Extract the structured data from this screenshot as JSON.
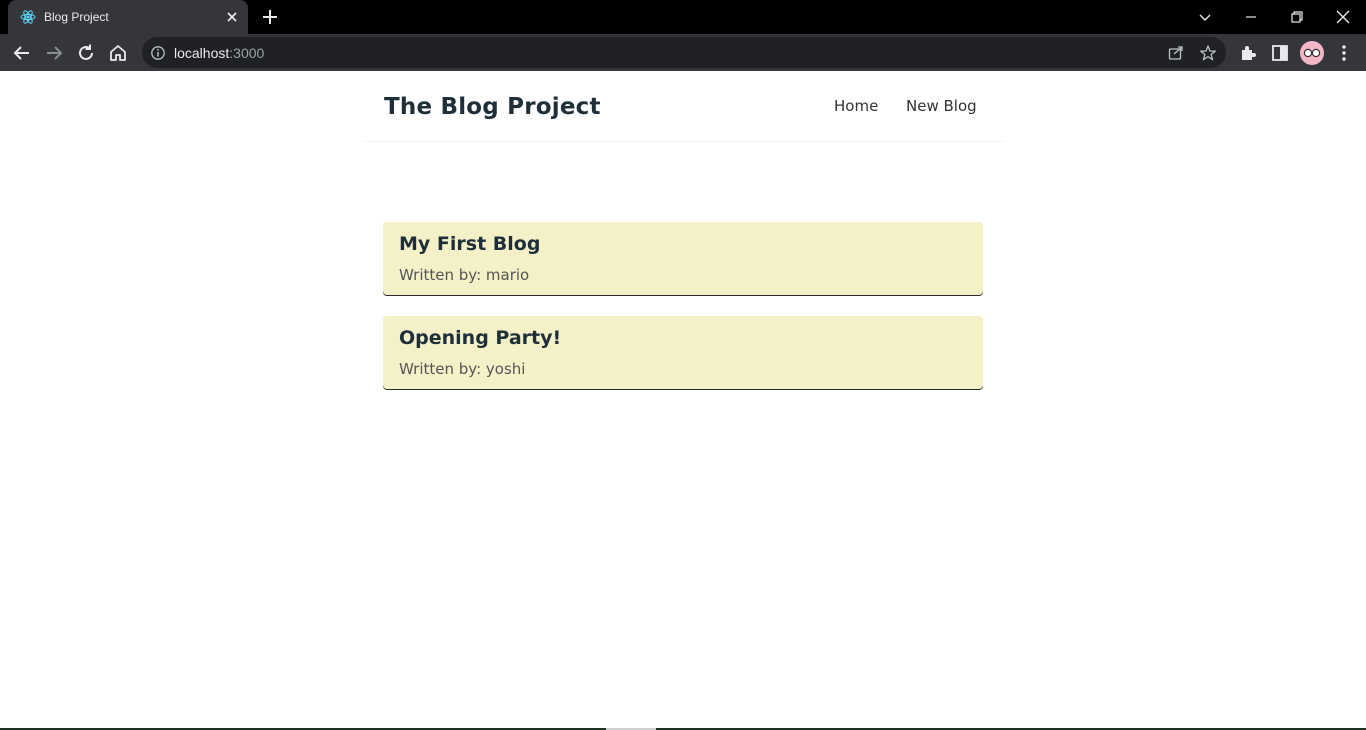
{
  "browser": {
    "tab_title": "Blog Project",
    "url_host": "localhost",
    "url_port": ":3000"
  },
  "site": {
    "brand": "The Blog Project",
    "nav": [
      {
        "label": "Home"
      },
      {
        "label": "New Blog"
      }
    ]
  },
  "blogs": [
    {
      "title": "My First Blog",
      "author_line": "Written by: mario"
    },
    {
      "title": "Opening Party!",
      "author_line": "Written by: yoshi"
    }
  ],
  "colors": {
    "blog_card_bg": "#f4f0c7",
    "heading_text": "#1e2f3a",
    "browser_chrome": "#35363a"
  },
  "icons": [
    "react-favicon-icon",
    "close-icon",
    "plus-icon",
    "chevron-down-icon",
    "minimize-icon",
    "restore-icon",
    "close-window-icon",
    "back-arrow-icon",
    "forward-arrow-icon",
    "reload-icon",
    "home-icon",
    "info-icon",
    "share-icon",
    "star-icon",
    "extensions-icon",
    "side-panel-icon",
    "profile-avatar",
    "more-menu-icon"
  ]
}
